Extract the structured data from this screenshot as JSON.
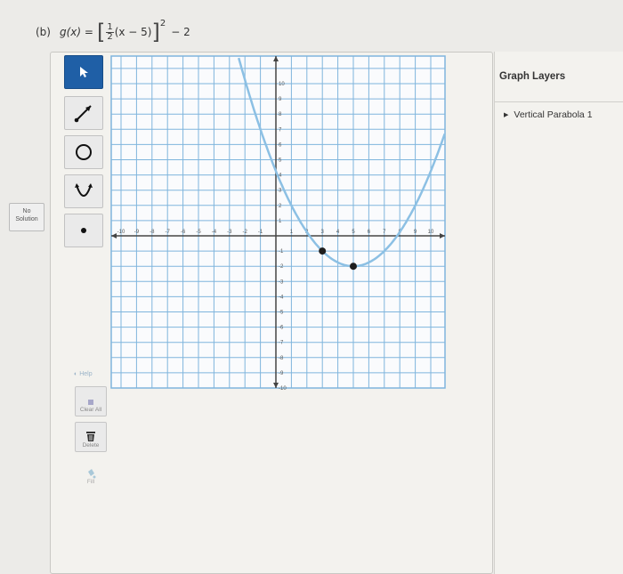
{
  "problem": {
    "label": "(b)",
    "function_name": "g(x) =",
    "open_bracket": "[",
    "frac_num": "1",
    "frac_den": "2",
    "inner": "(x − 5)",
    "close_bracket": "]",
    "exponent": "2",
    "tail": "− 2"
  },
  "toolbar": {
    "tools": [
      {
        "name": "arrow-tool-button",
        "icon": "pointer-icon",
        "active": true
      },
      {
        "name": "line-tool-button",
        "icon": "line-icon",
        "active": false
      },
      {
        "name": "circle-tool-button",
        "icon": "circle-icon",
        "active": false
      },
      {
        "name": "parabola-tool-button",
        "icon": "parabola-icon",
        "active": false
      },
      {
        "name": "point-tool-button",
        "icon": "point-icon",
        "active": false
      }
    ],
    "no_solution_line1": "No",
    "no_solution_line2": "Solution",
    "help_label": "Help",
    "clear_all_label": "Clear All",
    "delete_label": "Delete",
    "fill_label": "Fill"
  },
  "layers_panel": {
    "title": "Graph Layers",
    "items": [
      {
        "label": "Vertical Parabola 1"
      }
    ]
  },
  "graph": {
    "x_ticks": [
      "-10",
      "-9",
      "-8",
      "-7",
      "-6",
      "-5",
      "-4",
      "-3",
      "-2",
      "-1",
      "1",
      "2",
      "3",
      "4",
      "5",
      "6",
      "7",
      "8",
      "9",
      "10"
    ],
    "y_ticks": [
      "10",
      "9",
      "8",
      "7",
      "6",
      "5",
      "4",
      "3",
      "2",
      "1",
      "-1",
      "-2",
      "-3",
      "-4",
      "-5",
      "-6",
      "-7",
      "-8",
      "-9",
      "-10"
    ],
    "x_range": [
      -10,
      10
    ],
    "y_range": [
      -10,
      10
    ],
    "grid": true,
    "curve_color": "#8cc0e4",
    "point_color": "#1e1e1e",
    "axis_color": "#444444",
    "grid_color": "#7fb5dd",
    "parabola": {
      "a": 0.25,
      "h": 5,
      "k": -2
    },
    "points": [
      {
        "x": 3,
        "y": -1
      },
      {
        "x": 5,
        "y": -2
      }
    ]
  }
}
